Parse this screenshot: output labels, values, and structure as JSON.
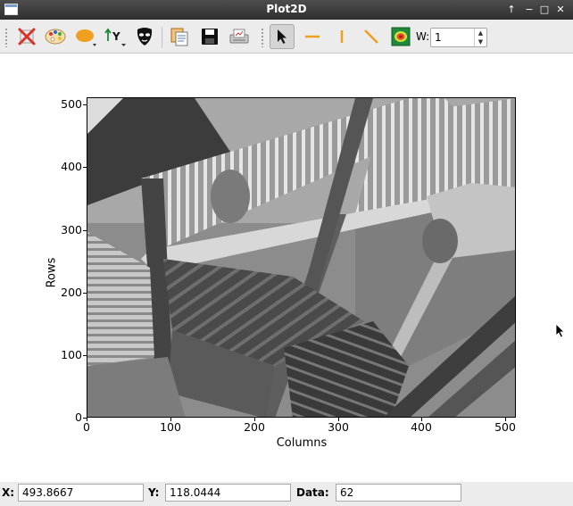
{
  "window": {
    "title": "Plot2D",
    "controls": [
      "↑",
      "−",
      "□",
      "✕"
    ]
  },
  "toolbar": {
    "buttons": [
      {
        "name": "reset-zoom-icon"
      },
      {
        "name": "colormap-icon"
      },
      {
        "name": "aspect-ratio-icon"
      },
      {
        "name": "y-axis-inverted-icon"
      },
      {
        "name": "mask-icon"
      },
      {
        "name": "copy-icon"
      },
      {
        "name": "save-icon"
      },
      {
        "name": "print-icon"
      },
      {
        "name": "pointer-icon",
        "active": true
      },
      {
        "name": "horizontal-line-icon"
      },
      {
        "name": "vertical-line-icon"
      },
      {
        "name": "diagonal-line-icon"
      },
      {
        "name": "image-profile-icon"
      }
    ],
    "width_label": "W:",
    "width_value": "1"
  },
  "plot": {
    "xlabel": "Columns",
    "ylabel": "Rows",
    "xticks": [
      "0",
      "100",
      "200",
      "300",
      "400",
      "500"
    ],
    "yticks": [
      "500",
      "400",
      "300",
      "200",
      "100",
      "0"
    ],
    "colormap": "gray"
  },
  "status": {
    "x_label": "X:",
    "x_value": "493.8667",
    "y_label": "Y:",
    "y_value": "118.0444",
    "data_label": "Data:",
    "data_value": "62"
  },
  "colors": {
    "accent_orange": "#f0a020",
    "titlebar": "#3a3a3a"
  }
}
